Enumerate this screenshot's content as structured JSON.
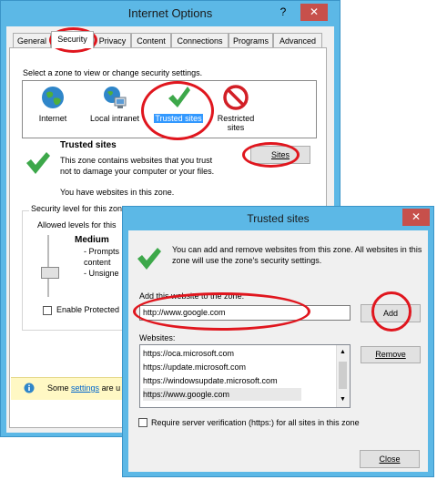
{
  "internet_options": {
    "title": "Internet Options",
    "help_glyph": "?",
    "close_glyph": "✕",
    "tabs": [
      "General",
      "Security",
      "Privacy",
      "Content",
      "Connections",
      "Programs",
      "Advanced"
    ],
    "zone_prompt": "Select a zone to view or change security settings.",
    "zones": [
      {
        "label": "Internet",
        "icon": "globe-icon"
      },
      {
        "label": "Local intranet",
        "icon": "intranet-icon"
      },
      {
        "label": "Trusted sites",
        "icon": "checkmark-icon"
      },
      {
        "label": "Restricted sites",
        "icon": "no-entry-icon"
      }
    ],
    "selected_zone_title": "Trusted sites",
    "selected_zone_desc": "This zone contains websites that you trust not to damage your computer or your files.",
    "selected_zone_note": "You have websites in this zone.",
    "sites_button": "Sites",
    "security_level_label": "Security level for this zone",
    "allowed_levels_label": "Allowed levels for this",
    "level_name": "Medium",
    "level_bullet_1": "- Prompts",
    "level_bullet_2": "content",
    "level_bullet_3": "- Unsigne",
    "enable_protected": "Enable Protected",
    "info_text_prefix": "Some",
    "info_link": "settings",
    "info_text_suffix": "are u"
  },
  "trusted_sites": {
    "title": "Trusted sites",
    "close_glyph": "✕",
    "info": "You can add and remove websites from this zone. All websites in this zone will use the zone's security settings.",
    "add_label": "Add this website to the zone:",
    "add_value": "http://www.google.com",
    "add_button": "Add",
    "websites_label": "Websites:",
    "websites": [
      "https://oca.microsoft.com",
      "https://update.microsoft.com",
      "https://windowsupdate.microsoft.com",
      "https://www.google.com"
    ],
    "remove_button": "Remove",
    "require_verification": "Require server verification (https:) for all sites in this zone",
    "close_button": "Close"
  },
  "colors": {
    "title_bar": "#5cb8e6",
    "close_red": "#c7504b",
    "annotation_red": "#e0161e",
    "selection_blue": "#3399ff",
    "check_green": "#3da84a"
  }
}
